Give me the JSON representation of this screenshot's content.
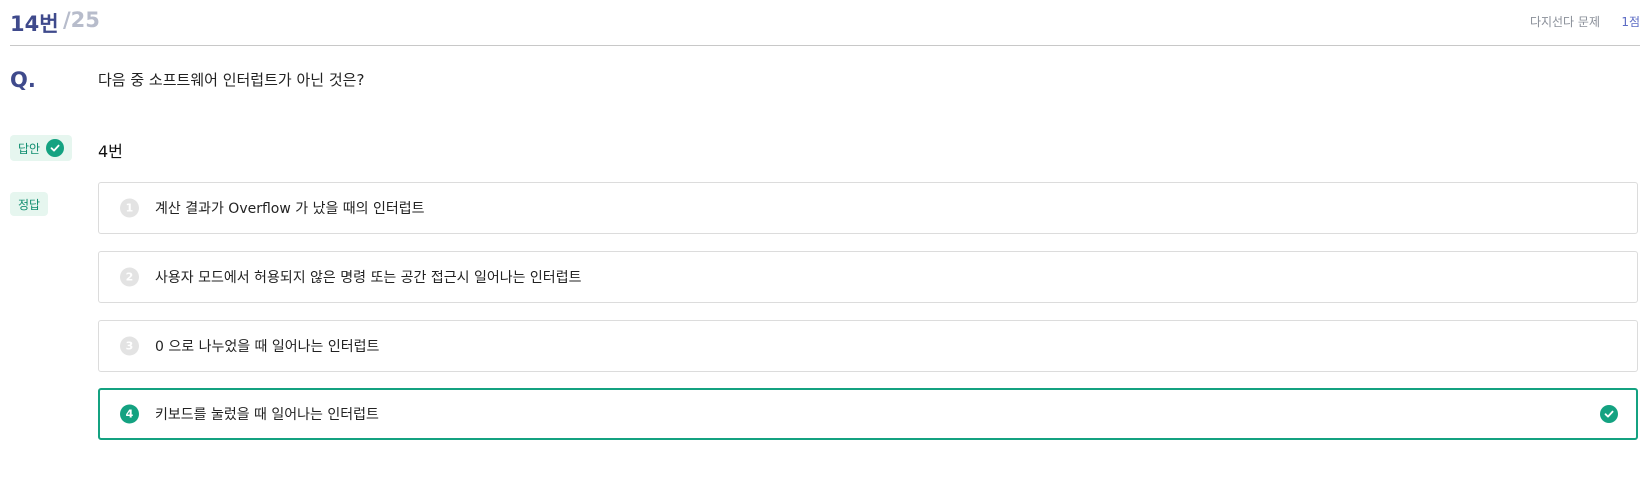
{
  "header": {
    "question_number": "14번",
    "total": "/25",
    "type": "다지선다 문제",
    "points": "1점"
  },
  "question": {
    "label": "Q.",
    "text": "다음 중 소프트웨어 인터럽트가 아닌 것은?"
  },
  "answer": {
    "label": "답안",
    "value": "4번"
  },
  "correct": {
    "label": "정답"
  },
  "options": [
    {
      "number": "1",
      "text": "계산 결과가 Overflow 가 났을 때의 인터럽트"
    },
    {
      "number": "2",
      "text": "사용자 모드에서 허용되지 않은 명령 또는 공간 접근시 일어나는 인터럽트"
    },
    {
      "number": "3",
      "text": "0 으로 나누었을 때 일어나는 인터럽트"
    },
    {
      "number": "4",
      "text": "키보드를 눌렀을 때 일어나는 인터럽트",
      "is_correct": true
    }
  ],
  "colors": {
    "accent": "#14a281",
    "title": "#3f4a8c",
    "muted": "#b7bccb"
  },
  "icons": {
    "check": "check-circle-icon"
  }
}
